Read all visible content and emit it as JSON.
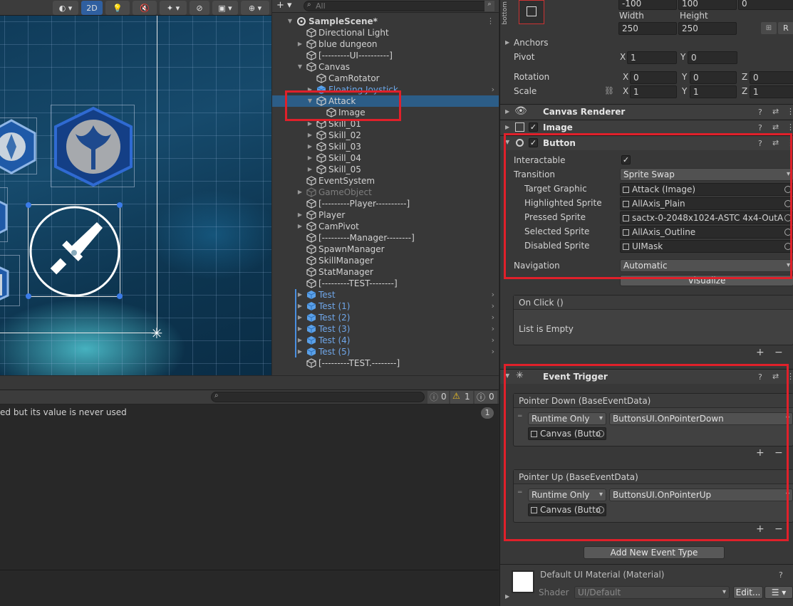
{
  "scene_toolbar": {
    "btn_2d": "2D"
  },
  "hierarchy": {
    "search_placeholder": "All",
    "items": [
      {
        "label": "SampleScene*",
        "kind": "scene"
      },
      {
        "label": "Directional Light"
      },
      {
        "label": "blue dungeon"
      },
      {
        "label": "[---------UI----------]"
      },
      {
        "label": "Canvas"
      },
      {
        "label": "CamRotator"
      },
      {
        "label": "Floating Joystick",
        "kind": "prefab"
      },
      {
        "label": "Attack",
        "kind": "selected"
      },
      {
        "label": "Image"
      },
      {
        "label": "Skill_01"
      },
      {
        "label": "Skill_02"
      },
      {
        "label": "Skill_03"
      },
      {
        "label": "Skill_04"
      },
      {
        "label": "Skill_05"
      },
      {
        "label": "EventSystem"
      },
      {
        "label": "GameObject",
        "kind": "disabled"
      },
      {
        "label": "[---------Player----------]"
      },
      {
        "label": "Player"
      },
      {
        "label": "CamPivot"
      },
      {
        "label": "[---------Manager--------]"
      },
      {
        "label": "SpawnManager"
      },
      {
        "label": "SkillManager"
      },
      {
        "label": "StatManager"
      },
      {
        "label": "[---------TEST--------]"
      },
      {
        "label": "Test",
        "kind": "prefab"
      },
      {
        "label": "Test (1)",
        "kind": "prefab"
      },
      {
        "label": "Test (2)",
        "kind": "prefab"
      },
      {
        "label": "Test (3)",
        "kind": "prefab"
      },
      {
        "label": "Test (4)",
        "kind": "prefab"
      },
      {
        "label": "Test (5)",
        "kind": "prefab"
      },
      {
        "label": "[---------TEST.--------]"
      }
    ]
  },
  "console": {
    "error_count": "0",
    "warning_count": "1",
    "message_count": "0",
    "message": "ed but its value is never used",
    "message_count_badge": "1"
  },
  "inspector": {
    "rect": {
      "anchor_label": "bottom",
      "pos_values": [
        "-100",
        "100",
        "0"
      ],
      "width_label": "Width",
      "height_label": "Height",
      "width": "250",
      "height": "250",
      "r_label": "R",
      "anchors_label": "Anchors",
      "pivot_label": "Pivot",
      "pivot_x": "1",
      "pivot_y": "0",
      "rotation_label": "Rotation",
      "rot_x": "0",
      "rot_y": "0",
      "rot_z": "0",
      "scale_label": "Scale",
      "scale_x": "1",
      "scale_y": "1",
      "scale_z": "1",
      "x": "X",
      "y": "Y",
      "z": "Z"
    },
    "canvas_renderer": {
      "title": "Canvas Renderer"
    },
    "image": {
      "title": "Image"
    },
    "button": {
      "title": "Button",
      "interactable_label": "Interactable",
      "transition_label": "Transition",
      "transition_value": "Sprite Swap",
      "target_graphic_label": "Target Graphic",
      "target_graphic_value": "Attack (Image)",
      "highlighted_label": "Highlighted Sprite",
      "highlighted_value": "AllAxis_Plain",
      "pressed_label": "Pressed Sprite",
      "pressed_value": "sactx-0-2048x1024-ASTC 4x4-OutA",
      "selected_label": "Selected Sprite",
      "selected_value": "AllAxis_Outline",
      "disabled_label": "Disabled Sprite",
      "disabled_value": "UIMask",
      "navigation_label": "Navigation",
      "navigation_value": "Automatic",
      "visualize_label": "Visualize",
      "onclick_label": "On Click ()",
      "list_empty": "List is Empty"
    },
    "event_trigger": {
      "title": "Event Trigger",
      "entries": [
        {
          "header": "Pointer Down (BaseEventData)",
          "runtime": "Runtime Only",
          "function": "ButtonsUI.OnPointerDown",
          "object": "Canvas (Butto"
        },
        {
          "header": "Pointer Up (BaseEventData)",
          "runtime": "Runtime Only",
          "function": "ButtonsUI.OnPointerUp",
          "object": "Canvas (Butto"
        }
      ],
      "add_button": "Add New Event Type"
    },
    "material": {
      "title": "Default UI Material (Material)",
      "shader_label": "Shader",
      "shader_value": "UI/Default",
      "edit_label": "Edit..."
    },
    "plus": "+",
    "minus": "−"
  },
  "colors": {
    "selection": "#2c5d87",
    "prefab": "#6fa6e8",
    "highlight_red": "#e0202a"
  }
}
